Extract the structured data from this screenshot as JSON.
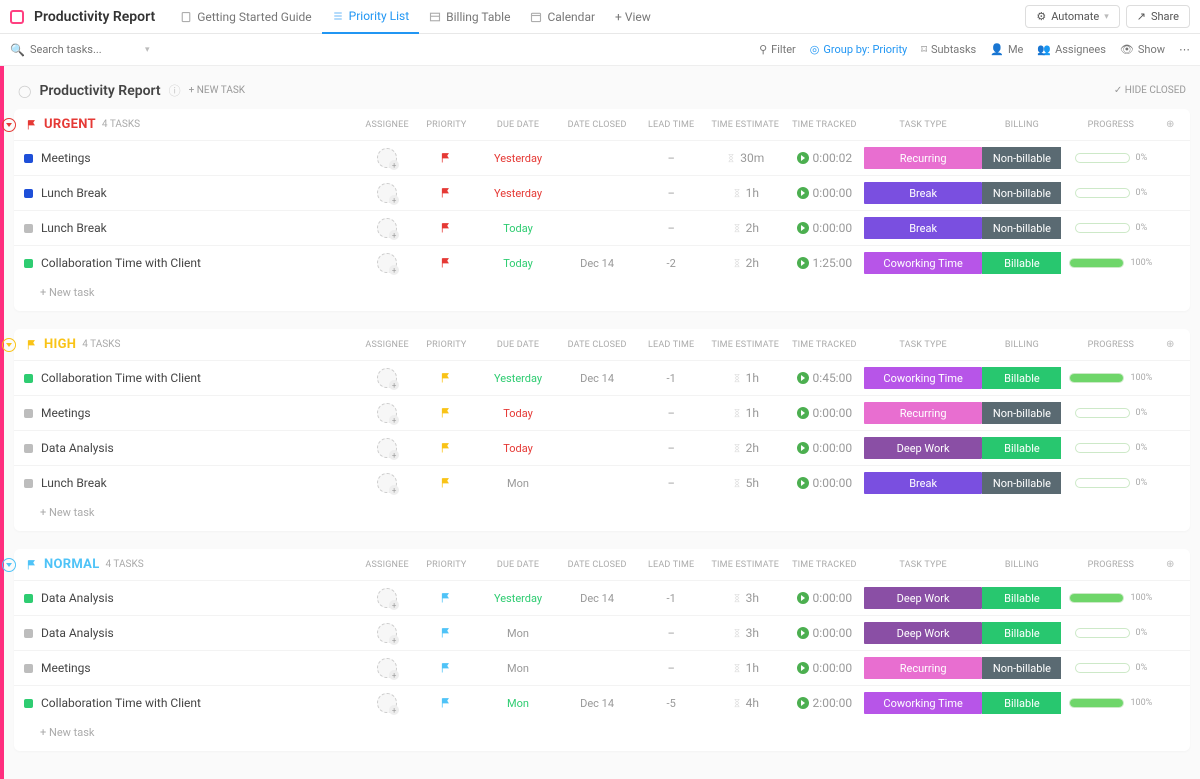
{
  "header": {
    "title": "Productivity Report",
    "tabs": [
      {
        "label": "Getting Started Guide"
      },
      {
        "label": "Priority List",
        "active": true
      },
      {
        "label": "Billing Table"
      },
      {
        "label": "Calendar"
      }
    ],
    "add_view": "+ View",
    "automate": "Automate",
    "share": "Share"
  },
  "toolbar": {
    "search_placeholder": "Search tasks...",
    "filter": "Filter",
    "group_by": "Group by: Priority",
    "subtasks": "Subtasks",
    "me": "Me",
    "assignees": "Assignees",
    "show": "Show"
  },
  "report": {
    "title": "Productivity Report",
    "new_task": "+ NEW TASK",
    "hide_closed": "HIDE CLOSED"
  },
  "columns": {
    "assignee": "ASSIGNEE",
    "priority": "PRIORITY",
    "due": "DUE DATE",
    "closed": "DATE CLOSED",
    "lead": "LEAD TIME",
    "est": "TIME ESTIMATE",
    "tracked": "TIME TRACKED",
    "type": "TASK TYPE",
    "billing": "BILLING",
    "progress": "PROGRESS"
  },
  "new_task_row": "+ New task",
  "colors": {
    "recurring": "#e86ed0",
    "break": "#7a4fe0",
    "coworking": "#b755e8",
    "deepwork": "#8a4fa5",
    "billable": "#28c76f",
    "nonbillable": "#5a6a72",
    "urgent": "#e53935",
    "high": "#f9c316",
    "normal": "#4fc3f7"
  },
  "groups": [
    {
      "name": "URGENT",
      "color": "#e53935",
      "count": "4 TASKS",
      "tasks": [
        {
          "name": "Meetings",
          "status_color": "#1e4fd8",
          "due": "Yesterday",
          "due_color": "#e53935",
          "closed": "",
          "lead": "–",
          "est": "30m",
          "tracked": "0:00:02",
          "type": "Recurring",
          "type_color": "#e86ed0",
          "billing": "Non-billable",
          "billing_color": "#5a6a72",
          "progress": 0
        },
        {
          "name": "Lunch Break",
          "status_color": "#1e4fd8",
          "due": "Yesterday",
          "due_color": "#e53935",
          "closed": "",
          "lead": "–",
          "est": "1h",
          "tracked": "0:00:00",
          "type": "Break",
          "type_color": "#7a4fe0",
          "billing": "Non-billable",
          "billing_color": "#5a6a72",
          "progress": 0
        },
        {
          "name": "Lunch Break",
          "status_color": "#bdbdbd",
          "due": "Today",
          "due_color": "#2ecc71",
          "closed": "",
          "lead": "–",
          "est": "2h",
          "tracked": "0:00:00",
          "type": "Break",
          "type_color": "#7a4fe0",
          "billing": "Non-billable",
          "billing_color": "#5a6a72",
          "progress": 0
        },
        {
          "name": "Collaboration Time with Client",
          "status_color": "#2ecc71",
          "due": "Today",
          "due_color": "#2ecc71",
          "closed": "Dec 14",
          "lead": "-2",
          "est": "2h",
          "tracked": "1:25:00",
          "type": "Coworking Time",
          "type_color": "#b755e8",
          "billing": "Billable",
          "billing_color": "#28c76f",
          "progress": 100
        }
      ]
    },
    {
      "name": "HIGH",
      "color": "#f9c316",
      "count": "4 TASKS",
      "tasks": [
        {
          "name": "Collaboration Time with Client",
          "status_color": "#2ecc71",
          "due": "Yesterday",
          "due_color": "#2ecc71",
          "closed": "Dec 14",
          "lead": "-1",
          "est": "1h",
          "tracked": "0:45:00",
          "type": "Coworking Time",
          "type_color": "#b755e8",
          "billing": "Billable",
          "billing_color": "#28c76f",
          "progress": 100
        },
        {
          "name": "Meetings",
          "status_color": "#bdbdbd",
          "due": "Today",
          "due_color": "#e53935",
          "closed": "",
          "lead": "–",
          "est": "1h",
          "tracked": "0:00:00",
          "type": "Recurring",
          "type_color": "#e86ed0",
          "billing": "Non-billable",
          "billing_color": "#5a6a72",
          "progress": 0
        },
        {
          "name": "Data Analysis",
          "status_color": "#bdbdbd",
          "due": "Today",
          "due_color": "#e53935",
          "closed": "",
          "lead": "–",
          "est": "2h",
          "tracked": "0:00:00",
          "type": "Deep Work",
          "type_color": "#8a4fa5",
          "billing": "Billable",
          "billing_color": "#28c76f",
          "progress": 0
        },
        {
          "name": "Lunch Break",
          "status_color": "#bdbdbd",
          "due": "Mon",
          "due_color": "#999",
          "closed": "",
          "lead": "–",
          "est": "5h",
          "tracked": "0:00:00",
          "type": "Break",
          "type_color": "#7a4fe0",
          "billing": "Non-billable",
          "billing_color": "#5a6a72",
          "progress": 0
        }
      ]
    },
    {
      "name": "NORMAL",
      "color": "#4fc3f7",
      "count": "4 TASKS",
      "tasks": [
        {
          "name": "Data Analysis",
          "status_color": "#2ecc71",
          "due": "Yesterday",
          "due_color": "#2ecc71",
          "closed": "Dec 14",
          "lead": "-1",
          "est": "3h",
          "tracked": "0:00:00",
          "type": "Deep Work",
          "type_color": "#8a4fa5",
          "billing": "Billable",
          "billing_color": "#28c76f",
          "progress": 100
        },
        {
          "name": "Data Analysis",
          "status_color": "#bdbdbd",
          "due": "Mon",
          "due_color": "#999",
          "closed": "",
          "lead": "–",
          "est": "3h",
          "tracked": "0:00:00",
          "type": "Deep Work",
          "type_color": "#8a4fa5",
          "billing": "Billable",
          "billing_color": "#28c76f",
          "progress": 0
        },
        {
          "name": "Meetings",
          "status_color": "#bdbdbd",
          "due": "Mon",
          "due_color": "#999",
          "closed": "",
          "lead": "–",
          "est": "1h",
          "tracked": "0:00:00",
          "type": "Recurring",
          "type_color": "#e86ed0",
          "billing": "Non-billable",
          "billing_color": "#5a6a72",
          "progress": 0
        },
        {
          "name": "Collaboration Time with Client",
          "status_color": "#2ecc71",
          "due": "Mon",
          "due_color": "#2ecc71",
          "closed": "Dec 14",
          "lead": "-5",
          "est": "4h",
          "tracked": "2:00:00",
          "type": "Coworking Time",
          "type_color": "#b755e8",
          "billing": "Billable",
          "billing_color": "#28c76f",
          "progress": 100
        }
      ]
    }
  ]
}
